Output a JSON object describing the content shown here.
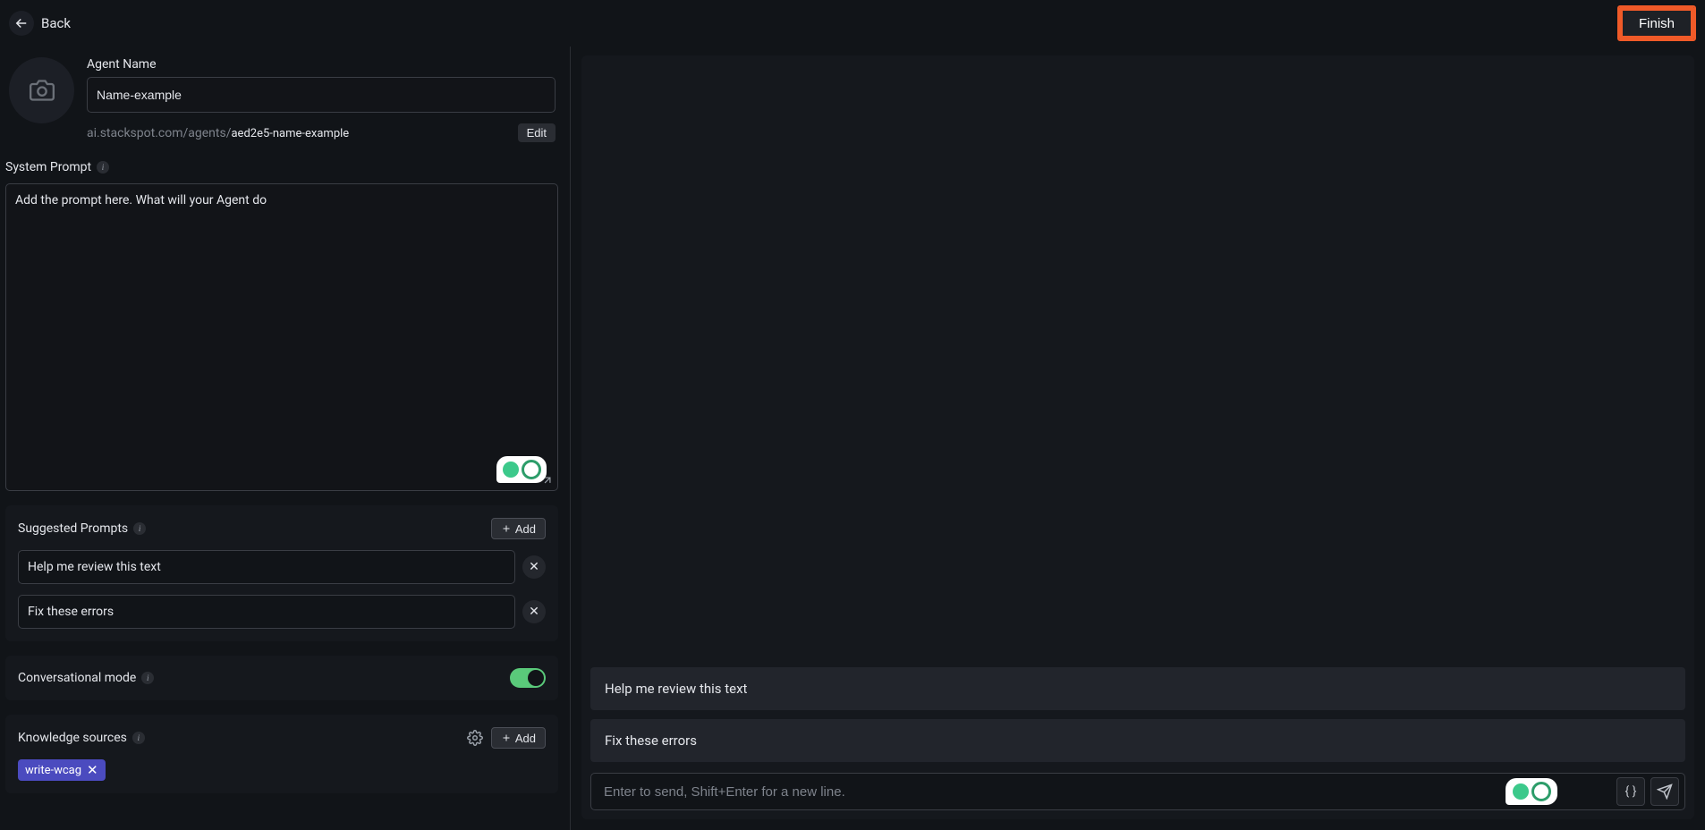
{
  "header": {
    "back_label": "Back",
    "finish_label": "Finish"
  },
  "agent": {
    "label": "Agent Name",
    "name_value": "Name-example",
    "slug_prefix": "ai.stackspot.com/agents/",
    "slug_name": "aed2e5-name-example",
    "edit_label": "Edit"
  },
  "system_prompt": {
    "label": "System Prompt",
    "placeholder": "Add the prompt here. What will your Agent do"
  },
  "suggested": {
    "label": "Suggested Prompts",
    "add_label": "Add",
    "items": [
      "Help me review this text",
      "Fix these errors"
    ]
  },
  "conversational": {
    "label": "Conversational mode",
    "enabled": true
  },
  "knowledge": {
    "label": "Knowledge sources",
    "add_label": "Add",
    "tags": [
      "write-wcag"
    ]
  },
  "chat": {
    "suggestions": [
      "Help me review this text",
      "Fix these errors"
    ],
    "input_placeholder": "Enter to send, Shift+Enter for a new line."
  }
}
